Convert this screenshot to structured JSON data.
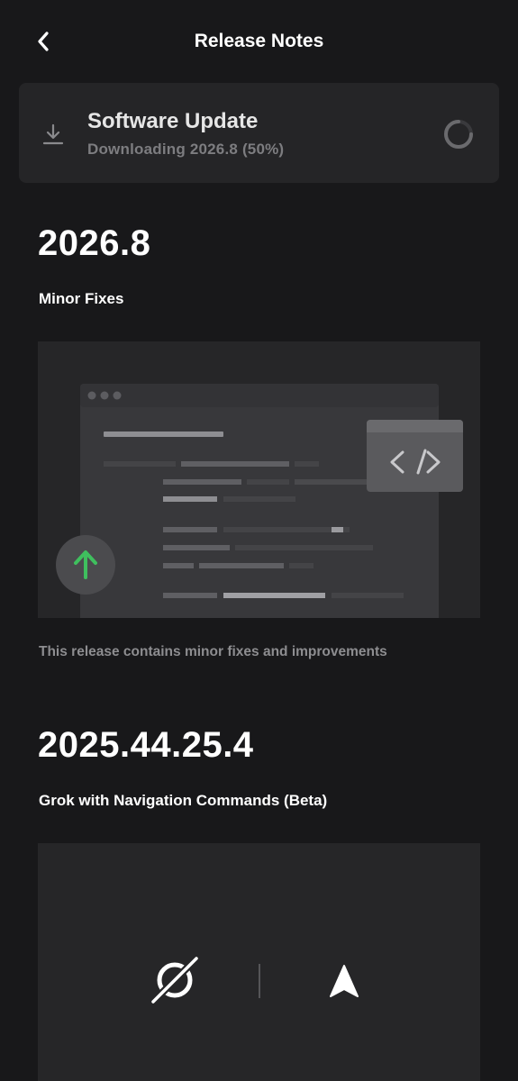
{
  "header": {
    "title": "Release Notes",
    "back_icon": "chevron-left-icon"
  },
  "update": {
    "title": "Software Update",
    "status": "Downloading 2026.8 (50%)",
    "progress": 0.5,
    "download_icon": "download-icon",
    "spinner_icon": "loading-spinner-icon"
  },
  "releases": [
    {
      "version": "2026.8",
      "feature": "Minor Fixes",
      "description": "This release contains minor fixes and improvements",
      "illustration_icons": [
        "code-icon",
        "arrow-up-icon"
      ]
    },
    {
      "version": "2025.44.25.4",
      "feature": "Grok with Navigation Commands (Beta)",
      "illustration_icons": [
        "grok-logo-icon",
        "navigation-arrow-icon"
      ]
    }
  ],
  "colors": {
    "background": "#18181a",
    "card": "#252527",
    "accent_green": "#3fbf5e",
    "text_muted": "#8d8d90"
  }
}
